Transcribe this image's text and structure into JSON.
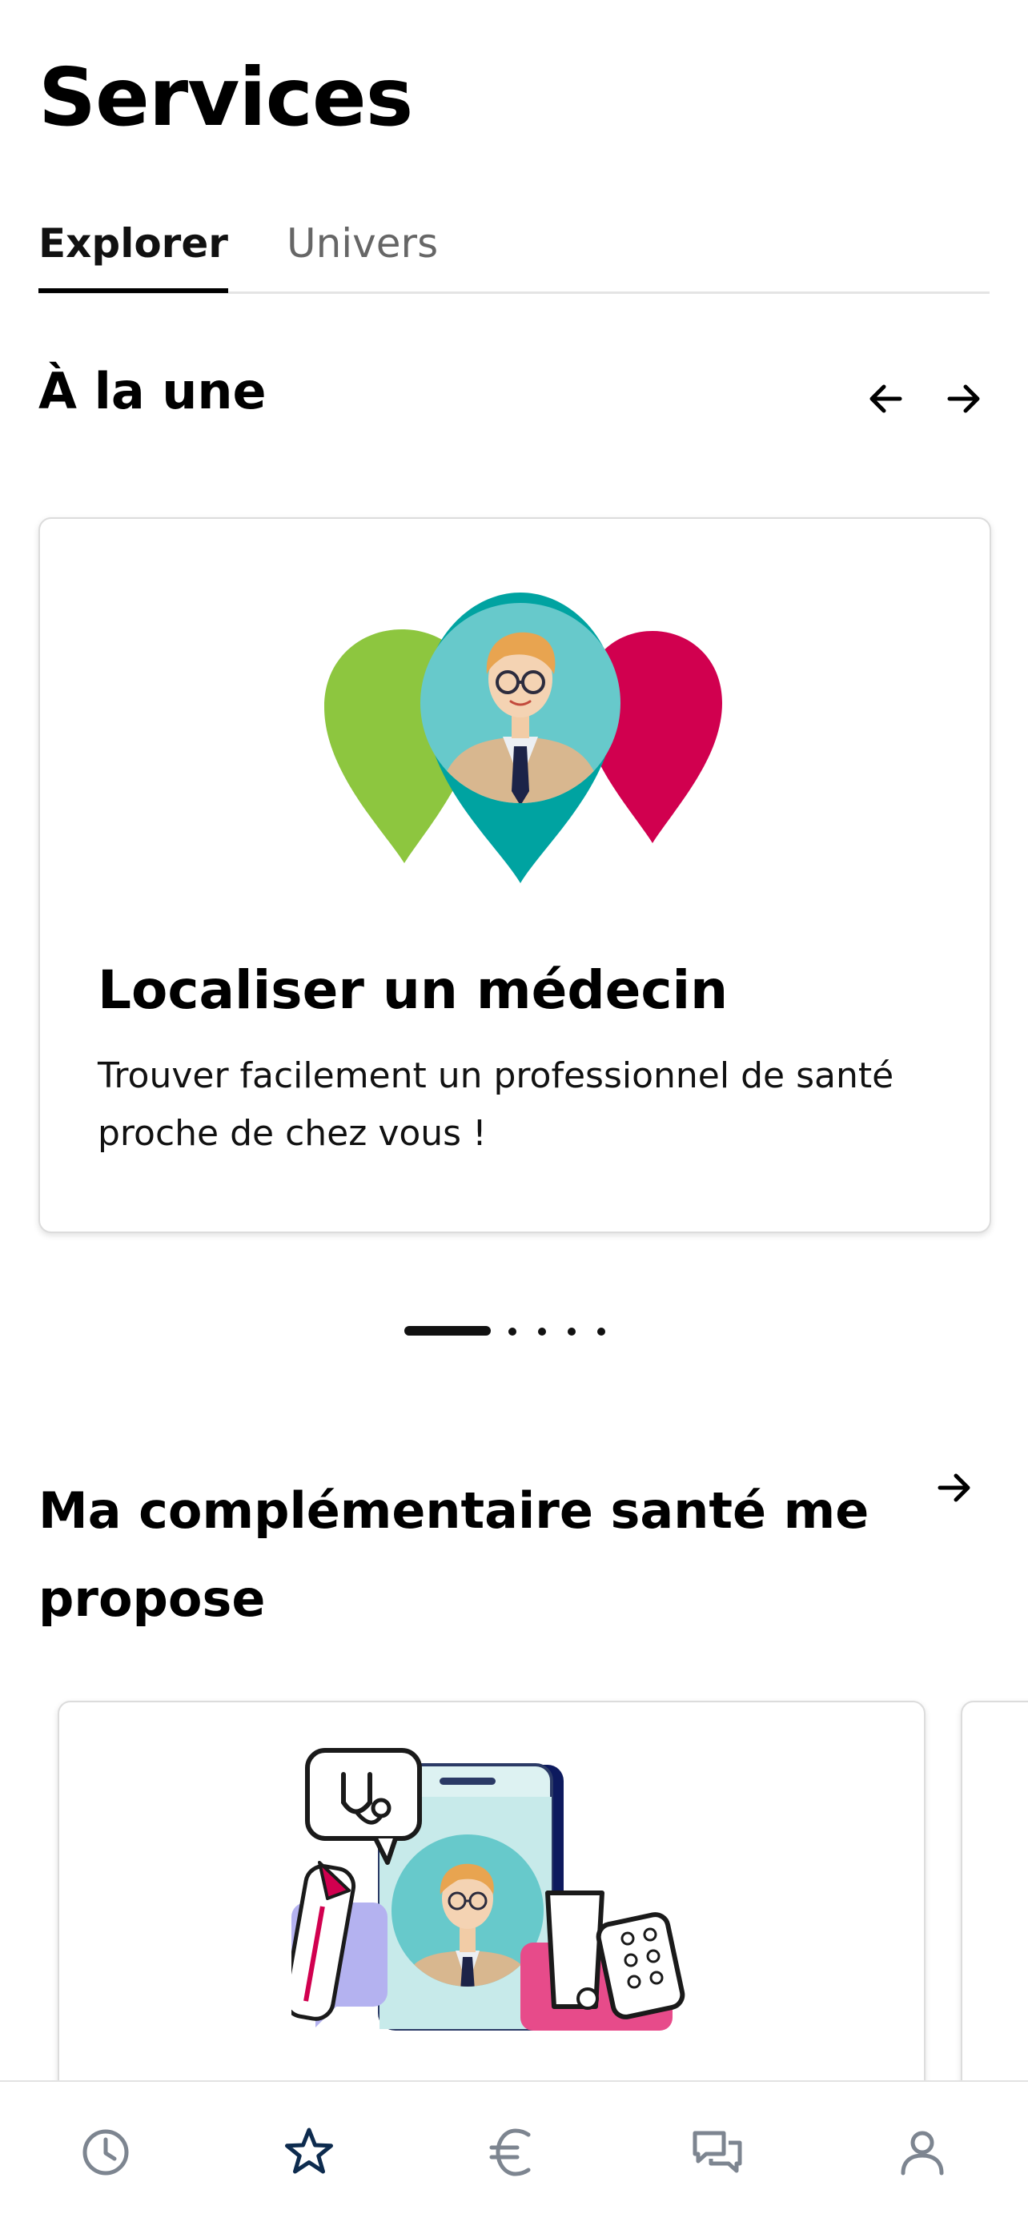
{
  "header": {
    "title": "Services"
  },
  "tabs": [
    {
      "label": "Explorer",
      "active": true
    },
    {
      "label": "Univers",
      "active": false
    }
  ],
  "featured": {
    "title": "À la une",
    "card": {
      "title": "Localiser un médecin",
      "description": "Trouver facilement un professionnel de santé proche de chez vous !",
      "icon": "doctor-location-pins-illustration"
    },
    "carousel": {
      "total": 5,
      "active": 1
    }
  },
  "complementary": {
    "title": "Ma complémentaire santé me propose",
    "card": {
      "icon": "teleconsultation-illustration"
    }
  },
  "bottom_nav": [
    {
      "name": "history",
      "icon": "clock-icon",
      "active": false
    },
    {
      "name": "services",
      "icon": "star-icon",
      "active": true
    },
    {
      "name": "reimbursements",
      "icon": "euro-icon",
      "active": false
    },
    {
      "name": "messages",
      "icon": "chat-icon",
      "active": false
    },
    {
      "name": "profile",
      "icon": "user-icon",
      "active": false
    }
  ],
  "colors": {
    "green": "#8DC63F",
    "teal": "#00A3A1",
    "crimson": "#D1004F",
    "navy": "#0D2B4E",
    "inactive_icon": "#7d8590"
  }
}
